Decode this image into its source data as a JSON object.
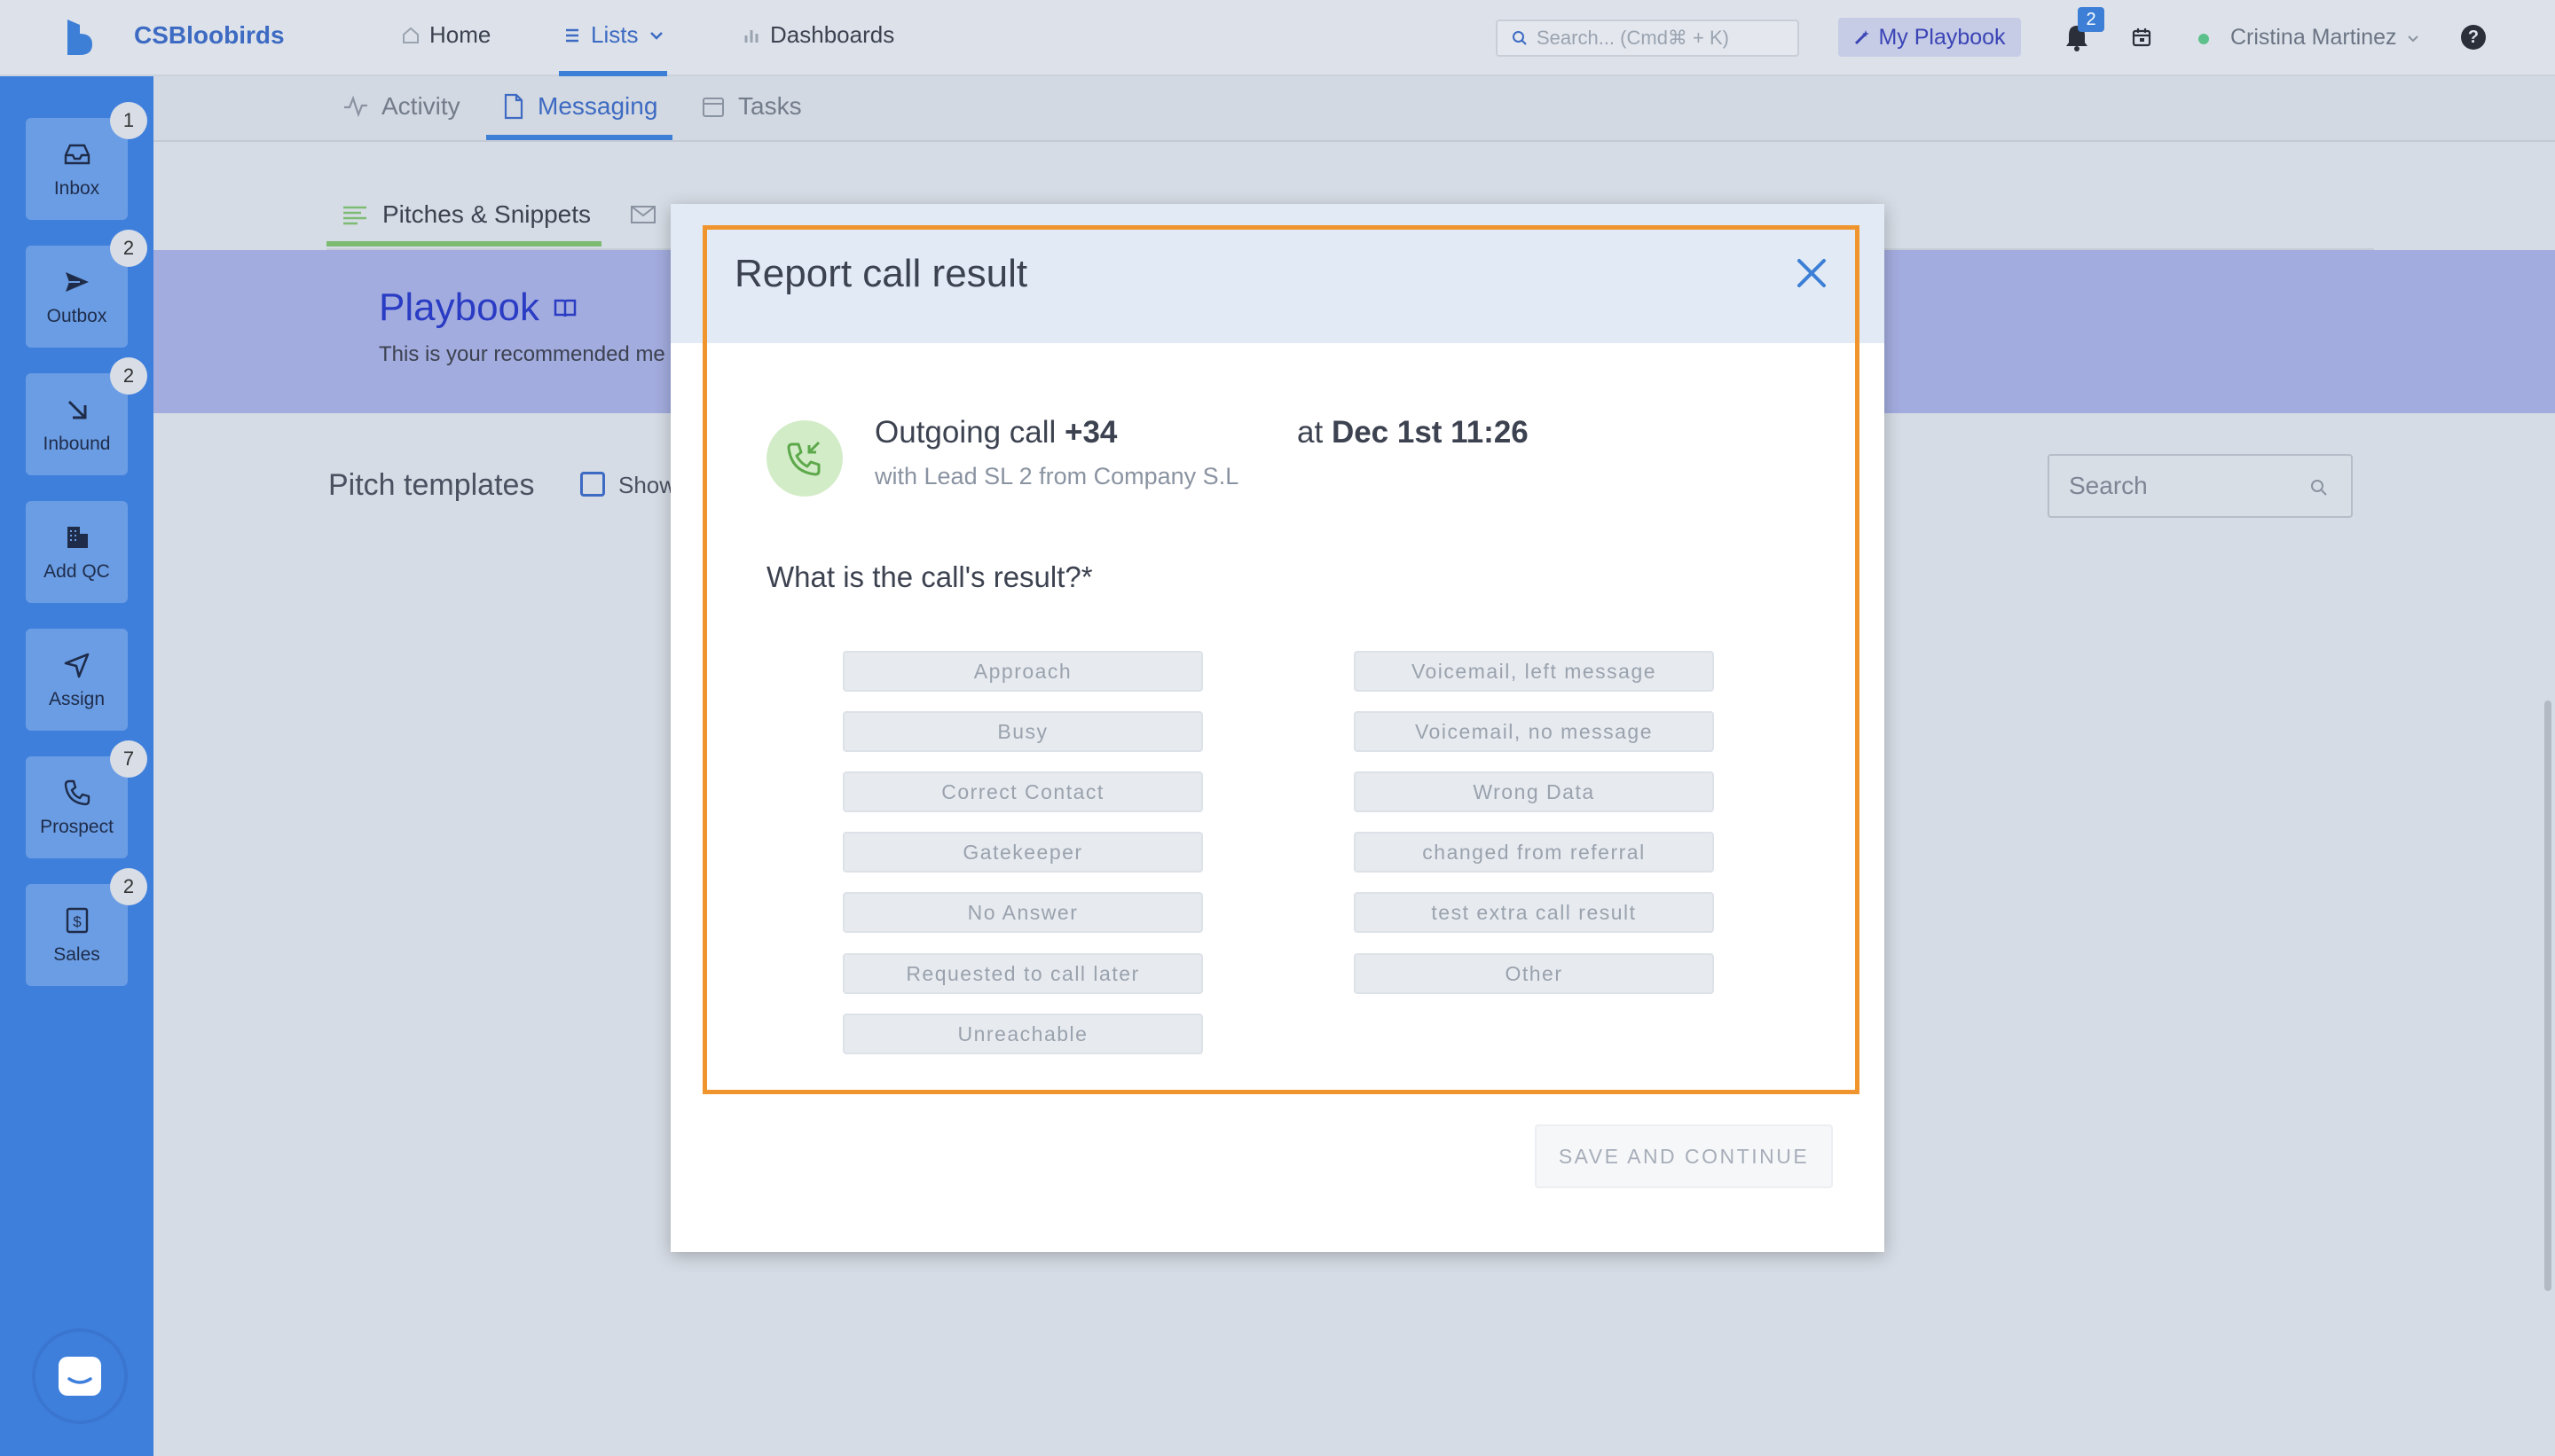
{
  "app": {
    "brand": "CSBloobirds",
    "nav": {
      "home": "Home",
      "lists": "Lists",
      "dashboards": "Dashboards"
    },
    "search_placeholder": "Search... (Cmd⌘ + K)",
    "playbook_button": "My Playbook",
    "notification_count": "2",
    "user_name": "Cristina Martinez",
    "help_glyph": "?"
  },
  "sidebar": {
    "items": [
      {
        "label": "Inbox",
        "badge": "1",
        "icon": "inbox-icon"
      },
      {
        "label": "Outbox",
        "badge": "2",
        "icon": "send-icon"
      },
      {
        "label": "Inbound",
        "badge": "2",
        "icon": "arrow-down-right-icon"
      },
      {
        "label": "Add QC",
        "badge": "",
        "icon": "building-icon"
      },
      {
        "label": "Assign",
        "badge": "",
        "icon": "navigation-icon"
      },
      {
        "label": "Prospect",
        "badge": "7",
        "icon": "phone-icon"
      },
      {
        "label": "Sales",
        "badge": "2",
        "icon": "dollar-icon"
      }
    ]
  },
  "subtabs": {
    "activity": "Activity",
    "messaging": "Messaging",
    "tasks": "Tasks"
  },
  "inner_tabs": {
    "pitches": "Pitches & Snippets"
  },
  "banner": {
    "title": "Playbook",
    "subtitle": "This is your recommended me"
  },
  "pitch": {
    "title": "Pitch templates",
    "show_label": "Show",
    "search_placeholder": "Search"
  },
  "modal": {
    "title": "Report call result",
    "call_prefix": "Outgoing call",
    "call_number": "+34",
    "call_at": "at",
    "call_date": "Dec 1st 11:26",
    "call_with": "with Lead SL 2 from Company S.L",
    "question": "What is the call's result?*",
    "results_left": [
      "Approach",
      "Busy",
      "Correct Contact",
      "Gatekeeper",
      "No Answer",
      "Requested to call later",
      "Unreachable"
    ],
    "results_right": [
      "Voicemail, left message",
      "Voicemail, no message",
      "Wrong Data",
      "changed from referral",
      "test extra call result",
      "Other"
    ],
    "save_button": "SAVE AND CONTINUE"
  },
  "colors": {
    "sidebar": "#3f7fdc",
    "accent": "#3d6ac2",
    "highlight": "#f0952d",
    "call_icon_bg": "#d3ecc8",
    "banner": "#a3acdf"
  }
}
